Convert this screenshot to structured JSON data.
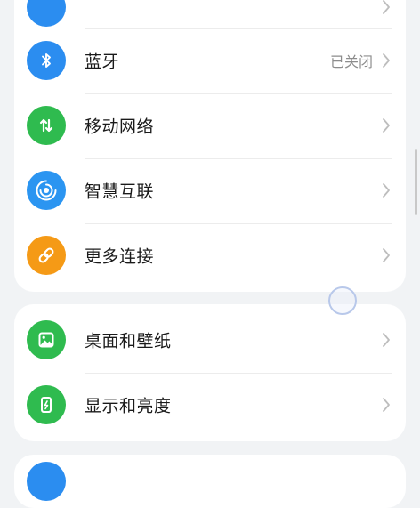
{
  "connections_card": {
    "items": [
      {
        "label": "",
        "value": "",
        "icon": "top-partial-icon",
        "color": "#2b8df0"
      },
      {
        "label": "蓝牙",
        "value": "已关闭",
        "icon": "bluetooth-icon",
        "color": "#2b8df0"
      },
      {
        "label": "移动网络",
        "value": "",
        "icon": "mobile-network-icon",
        "color": "#2fbb4f"
      },
      {
        "label": "智慧互联",
        "value": "",
        "icon": "smart-connect-icon",
        "color": "#2b95f1"
      },
      {
        "label": "更多连接",
        "value": "",
        "icon": "link-icon",
        "color": "#f59a16"
      }
    ]
  },
  "display_card": {
    "items": [
      {
        "label": "桌面和壁纸",
        "icon": "wallpaper-icon",
        "color": "#2fbb4f"
      },
      {
        "label": "显示和亮度",
        "icon": "display-brightness-icon",
        "color": "#2fbb4f"
      }
    ]
  }
}
